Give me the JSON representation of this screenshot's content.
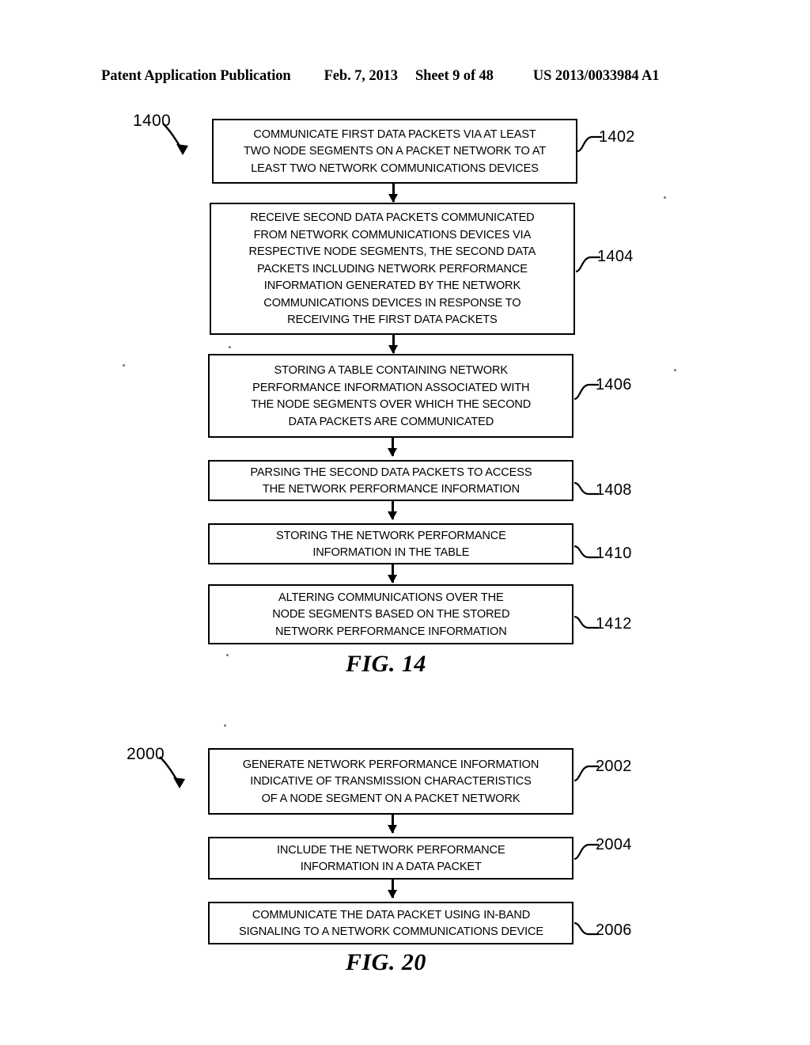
{
  "header": {
    "publication": "Patent Application Publication",
    "date": "Feb. 7, 2013",
    "sheet": "Sheet 9 of 48",
    "number": "US 2013/0033984 A1"
  },
  "figures": [
    {
      "id": "fig-14",
      "caption": "FIG. 14",
      "flow_ref": "1400",
      "steps": [
        {
          "ref": "1402",
          "text": "COMMUNICATE FIRST DATA PACKETS VIA AT LEAST\nTWO NODE SEGMENTS ON A PACKET NETWORK TO AT\nLEAST TWO NETWORK COMMUNICATIONS DEVICES"
        },
        {
          "ref": "1404",
          "text": "RECEIVE SECOND DATA PACKETS COMMUNICATED\nFROM NETWORK COMMUNICATIONS DEVICES VIA\nRESPECTIVE NODE SEGMENTS, THE SECOND DATA\nPACKETS INCLUDING NETWORK PERFORMANCE\nINFORMATION GENERATED BY THE NETWORK\nCOMMUNICATIONS DEVICES IN RESPONSE TO\nRECEIVING THE FIRST DATA PACKETS"
        },
        {
          "ref": "1406",
          "text": "STORING A TABLE CONTAINING NETWORK\nPERFORMANCE INFORMATION ASSOCIATED WITH\nTHE NODE SEGMENTS OVER WHICH THE SECOND\nDATA PACKETS ARE COMMUNICATED"
        },
        {
          "ref": "1408",
          "text": "PARSING THE SECOND DATA PACKETS TO ACCESS\nTHE NETWORK PERFORMANCE INFORMATION"
        },
        {
          "ref": "1410",
          "text": "STORING THE NETWORK PERFORMANCE\nINFORMATION IN THE TABLE"
        },
        {
          "ref": "1412",
          "text": "ALTERING COMMUNICATIONS OVER THE\nNODE SEGMENTS BASED ON THE STORED\nNETWORK PERFORMANCE INFORMATION"
        }
      ]
    },
    {
      "id": "fig-20",
      "caption": "FIG. 20",
      "flow_ref": "2000",
      "steps": [
        {
          "ref": "2002",
          "text": "GENERATE NETWORK PERFORMANCE INFORMATION\nINDICATIVE OF TRANSMISSION CHARACTERISTICS\nOF A NODE SEGMENT ON A PACKET NETWORK"
        },
        {
          "ref": "2004",
          "text": "INCLUDE THE NETWORK PERFORMANCE\nINFORMATION IN A DATA PACKET"
        },
        {
          "ref": "2006",
          "text": "COMMUNICATE THE DATA PACKET USING IN-BAND\nSIGNALING TO A NETWORK COMMUNICATIONS DEVICE"
        }
      ]
    }
  ],
  "colors": {
    "ink": "#000000",
    "paper": "#ffffff"
  }
}
